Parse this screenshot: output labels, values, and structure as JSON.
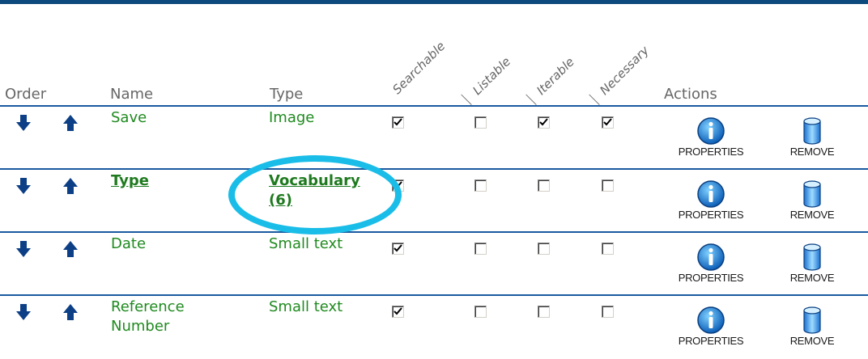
{
  "headers": {
    "order": "Order",
    "name": "Name",
    "type": "Type",
    "searchable": "Searchable",
    "listable": "Listable",
    "iterable": "Iterable",
    "necessary": "Necessary",
    "actions": "Actions"
  },
  "actions": {
    "properties_label": "PROPERTIES",
    "remove_label": "REMOVE"
  },
  "rows": [
    {
      "name": "Save",
      "type": "Image",
      "name_link": false,
      "type_line2": "",
      "searchable": true,
      "listable": false,
      "iterable": true,
      "necessary": true
    },
    {
      "name": "Type",
      "type": "Vocabulary",
      "name_link": true,
      "type_line2": "(6)",
      "searchable": true,
      "listable": false,
      "iterable": false,
      "necessary": false
    },
    {
      "name": "Date",
      "type": "Small text",
      "name_link": false,
      "type_line2": "",
      "searchable": true,
      "listable": false,
      "iterable": false,
      "necessary": false
    },
    {
      "name": "Reference",
      "name_line2": "Number",
      "type": "Small text",
      "name_link": false,
      "type_line2": "",
      "searchable": true,
      "listable": false,
      "iterable": false,
      "necessary": false
    }
  ],
  "colors": {
    "accent": "#1a5aa0",
    "text_green": "#1f8a1f",
    "highlight": "#19bde8"
  }
}
